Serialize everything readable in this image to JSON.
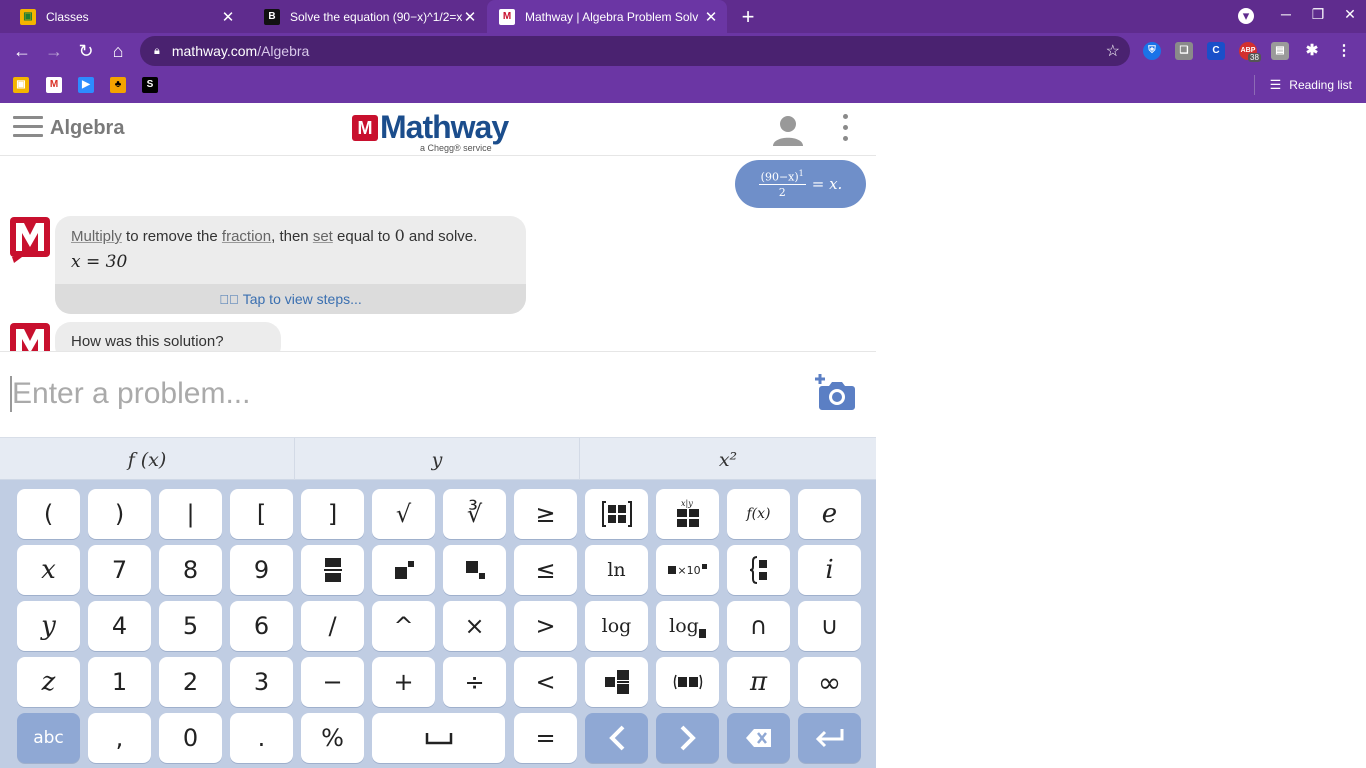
{
  "browser": {
    "tabs": [
      {
        "title": "Classes",
        "favicon": "classroom"
      },
      {
        "title": "Solve the equation (90−x)^1/2=x",
        "favicon": "bold-b"
      },
      {
        "title": "Mathway | Algebra Problem Solv",
        "favicon": "mathway",
        "active": true
      }
    ],
    "url_host": "mathway.com",
    "url_path": "/Algebra",
    "reading_list": "Reading list",
    "ext_badge": "38"
  },
  "header": {
    "subject": "Algebra",
    "logo_text": "Mathway",
    "logo_sub": "a Chegg® service"
  },
  "chat": {
    "user_frac_num": "(90−x)",
    "user_frac_exp": "1",
    "user_frac_den": "2",
    "user_rest": "= x.",
    "bot_parts": {
      "w1": "Multiply",
      "t1": " to remove the ",
      "w2": "fraction",
      "t2": ", then ",
      "w3": "set",
      "t3": " equal to ",
      "zero": "0",
      "t4": " and solve."
    },
    "bot_answer": "x = 30",
    "steps_label": "Tap to view steps...",
    "feedback": "How was this solution?"
  },
  "input": {
    "placeholder": "Enter a problem..."
  },
  "keyboard_tabs": [
    "f (x)",
    "y",
    "x²"
  ],
  "keys": [
    [
      "(",
      ")",
      "|",
      "[",
      "]",
      "√",
      "∛",
      "≥",
      "matrix",
      "table",
      "f(x)",
      "e"
    ],
    [
      "x",
      "7",
      "8",
      "9",
      "frac",
      "sup",
      "sub",
      "≤",
      "ln",
      "sci",
      "piecewise",
      "i"
    ],
    [
      "y",
      "4",
      "5",
      "6",
      "/",
      "^",
      "×",
      ">",
      "log",
      "log_b",
      "∩",
      "∪"
    ],
    [
      "z",
      "1",
      "2",
      "3",
      "−",
      "+",
      "÷",
      "<",
      "mixed",
      "paren",
      "π",
      "∞"
    ],
    [
      "abc",
      ",",
      "0",
      ".",
      "%",
      "space",
      "=",
      "left",
      "right",
      "backspace",
      "enter"
    ]
  ],
  "key_labels": {
    "fx": "f(x)",
    "ln": "ln",
    "log": "log",
    "logb": "log",
    "sci": "×10",
    "abc": "abc"
  },
  "colors": {
    "chrome": "#5f2c8e",
    "keyboard": "#c0cde3",
    "accent": "#1b4d8c",
    "brand_red": "#c8102e"
  }
}
